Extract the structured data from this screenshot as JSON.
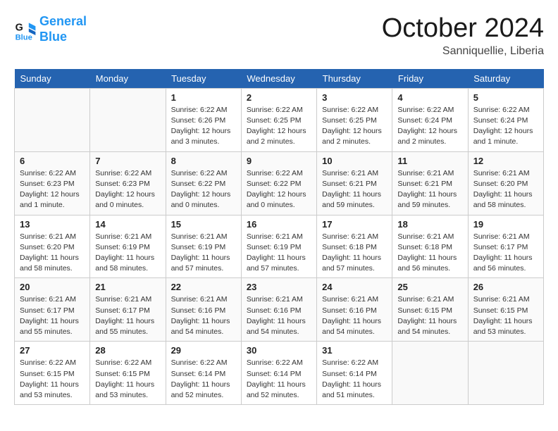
{
  "header": {
    "logo_line1": "General",
    "logo_line2": "Blue",
    "month": "October 2024",
    "location": "Sanniquellie, Liberia"
  },
  "weekdays": [
    "Sunday",
    "Monday",
    "Tuesday",
    "Wednesday",
    "Thursday",
    "Friday",
    "Saturday"
  ],
  "weeks": [
    [
      {
        "day": "",
        "info": ""
      },
      {
        "day": "",
        "info": ""
      },
      {
        "day": "1",
        "info": "Sunrise: 6:22 AM\nSunset: 6:26 PM\nDaylight: 12 hours\nand 3 minutes."
      },
      {
        "day": "2",
        "info": "Sunrise: 6:22 AM\nSunset: 6:25 PM\nDaylight: 12 hours\nand 2 minutes."
      },
      {
        "day": "3",
        "info": "Sunrise: 6:22 AM\nSunset: 6:25 PM\nDaylight: 12 hours\nand 2 minutes."
      },
      {
        "day": "4",
        "info": "Sunrise: 6:22 AM\nSunset: 6:24 PM\nDaylight: 12 hours\nand 2 minutes."
      },
      {
        "day": "5",
        "info": "Sunrise: 6:22 AM\nSunset: 6:24 PM\nDaylight: 12 hours\nand 1 minute."
      }
    ],
    [
      {
        "day": "6",
        "info": "Sunrise: 6:22 AM\nSunset: 6:23 PM\nDaylight: 12 hours\nand 1 minute."
      },
      {
        "day": "7",
        "info": "Sunrise: 6:22 AM\nSunset: 6:23 PM\nDaylight: 12 hours\nand 0 minutes."
      },
      {
        "day": "8",
        "info": "Sunrise: 6:22 AM\nSunset: 6:22 PM\nDaylight: 12 hours\nand 0 minutes."
      },
      {
        "day": "9",
        "info": "Sunrise: 6:22 AM\nSunset: 6:22 PM\nDaylight: 12 hours\nand 0 minutes."
      },
      {
        "day": "10",
        "info": "Sunrise: 6:21 AM\nSunset: 6:21 PM\nDaylight: 11 hours\nand 59 minutes."
      },
      {
        "day": "11",
        "info": "Sunrise: 6:21 AM\nSunset: 6:21 PM\nDaylight: 11 hours\nand 59 minutes."
      },
      {
        "day": "12",
        "info": "Sunrise: 6:21 AM\nSunset: 6:20 PM\nDaylight: 11 hours\nand 58 minutes."
      }
    ],
    [
      {
        "day": "13",
        "info": "Sunrise: 6:21 AM\nSunset: 6:20 PM\nDaylight: 11 hours\nand 58 minutes."
      },
      {
        "day": "14",
        "info": "Sunrise: 6:21 AM\nSunset: 6:19 PM\nDaylight: 11 hours\nand 58 minutes."
      },
      {
        "day": "15",
        "info": "Sunrise: 6:21 AM\nSunset: 6:19 PM\nDaylight: 11 hours\nand 57 minutes."
      },
      {
        "day": "16",
        "info": "Sunrise: 6:21 AM\nSunset: 6:19 PM\nDaylight: 11 hours\nand 57 minutes."
      },
      {
        "day": "17",
        "info": "Sunrise: 6:21 AM\nSunset: 6:18 PM\nDaylight: 11 hours\nand 57 minutes."
      },
      {
        "day": "18",
        "info": "Sunrise: 6:21 AM\nSunset: 6:18 PM\nDaylight: 11 hours\nand 56 minutes."
      },
      {
        "day": "19",
        "info": "Sunrise: 6:21 AM\nSunset: 6:17 PM\nDaylight: 11 hours\nand 56 minutes."
      }
    ],
    [
      {
        "day": "20",
        "info": "Sunrise: 6:21 AM\nSunset: 6:17 PM\nDaylight: 11 hours\nand 55 minutes."
      },
      {
        "day": "21",
        "info": "Sunrise: 6:21 AM\nSunset: 6:17 PM\nDaylight: 11 hours\nand 55 minutes."
      },
      {
        "day": "22",
        "info": "Sunrise: 6:21 AM\nSunset: 6:16 PM\nDaylight: 11 hours\nand 54 minutes."
      },
      {
        "day": "23",
        "info": "Sunrise: 6:21 AM\nSunset: 6:16 PM\nDaylight: 11 hours\nand 54 minutes."
      },
      {
        "day": "24",
        "info": "Sunrise: 6:21 AM\nSunset: 6:16 PM\nDaylight: 11 hours\nand 54 minutes."
      },
      {
        "day": "25",
        "info": "Sunrise: 6:21 AM\nSunset: 6:15 PM\nDaylight: 11 hours\nand 54 minutes."
      },
      {
        "day": "26",
        "info": "Sunrise: 6:21 AM\nSunset: 6:15 PM\nDaylight: 11 hours\nand 53 minutes."
      }
    ],
    [
      {
        "day": "27",
        "info": "Sunrise: 6:22 AM\nSunset: 6:15 PM\nDaylight: 11 hours\nand 53 minutes."
      },
      {
        "day": "28",
        "info": "Sunrise: 6:22 AM\nSunset: 6:15 PM\nDaylight: 11 hours\nand 53 minutes."
      },
      {
        "day": "29",
        "info": "Sunrise: 6:22 AM\nSunset: 6:14 PM\nDaylight: 11 hours\nand 52 minutes."
      },
      {
        "day": "30",
        "info": "Sunrise: 6:22 AM\nSunset: 6:14 PM\nDaylight: 11 hours\nand 52 minutes."
      },
      {
        "day": "31",
        "info": "Sunrise: 6:22 AM\nSunset: 6:14 PM\nDaylight: 11 hours\nand 51 minutes."
      },
      {
        "day": "",
        "info": ""
      },
      {
        "day": "",
        "info": ""
      }
    ]
  ]
}
